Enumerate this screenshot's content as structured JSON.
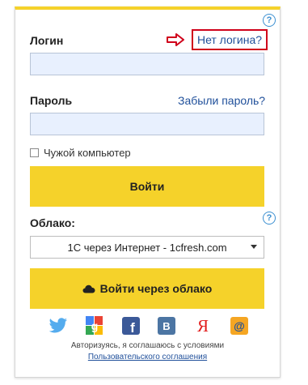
{
  "login": {
    "label": "Логин",
    "no_login_link": "Нет логина?",
    "help_icon": "?"
  },
  "password": {
    "label": "Пароль",
    "forgot_link": "Забыли пароль?"
  },
  "remember": {
    "label": "Чужой компьютер"
  },
  "submit_button": "Войти",
  "cloud": {
    "label": "Облако:",
    "help_icon": "?",
    "selected_option": "1С через Интернет - 1cfresh.com",
    "login_button": "Войти через облако"
  },
  "social_icons": [
    "twitter-icon",
    "google-icon",
    "facebook-icon",
    "vk-icon",
    "yandex-icon",
    "mailru-icon"
  ],
  "agreement": {
    "line1": "Авторизуясь, я соглашаюсь с условиями",
    "link": "Пользовательского соглашения"
  },
  "colors": {
    "accent_yellow": "#f5d22a",
    "input_bg": "#e8f0fe",
    "highlight_red": "#d0021b",
    "link_blue": "#1f4f9a"
  }
}
